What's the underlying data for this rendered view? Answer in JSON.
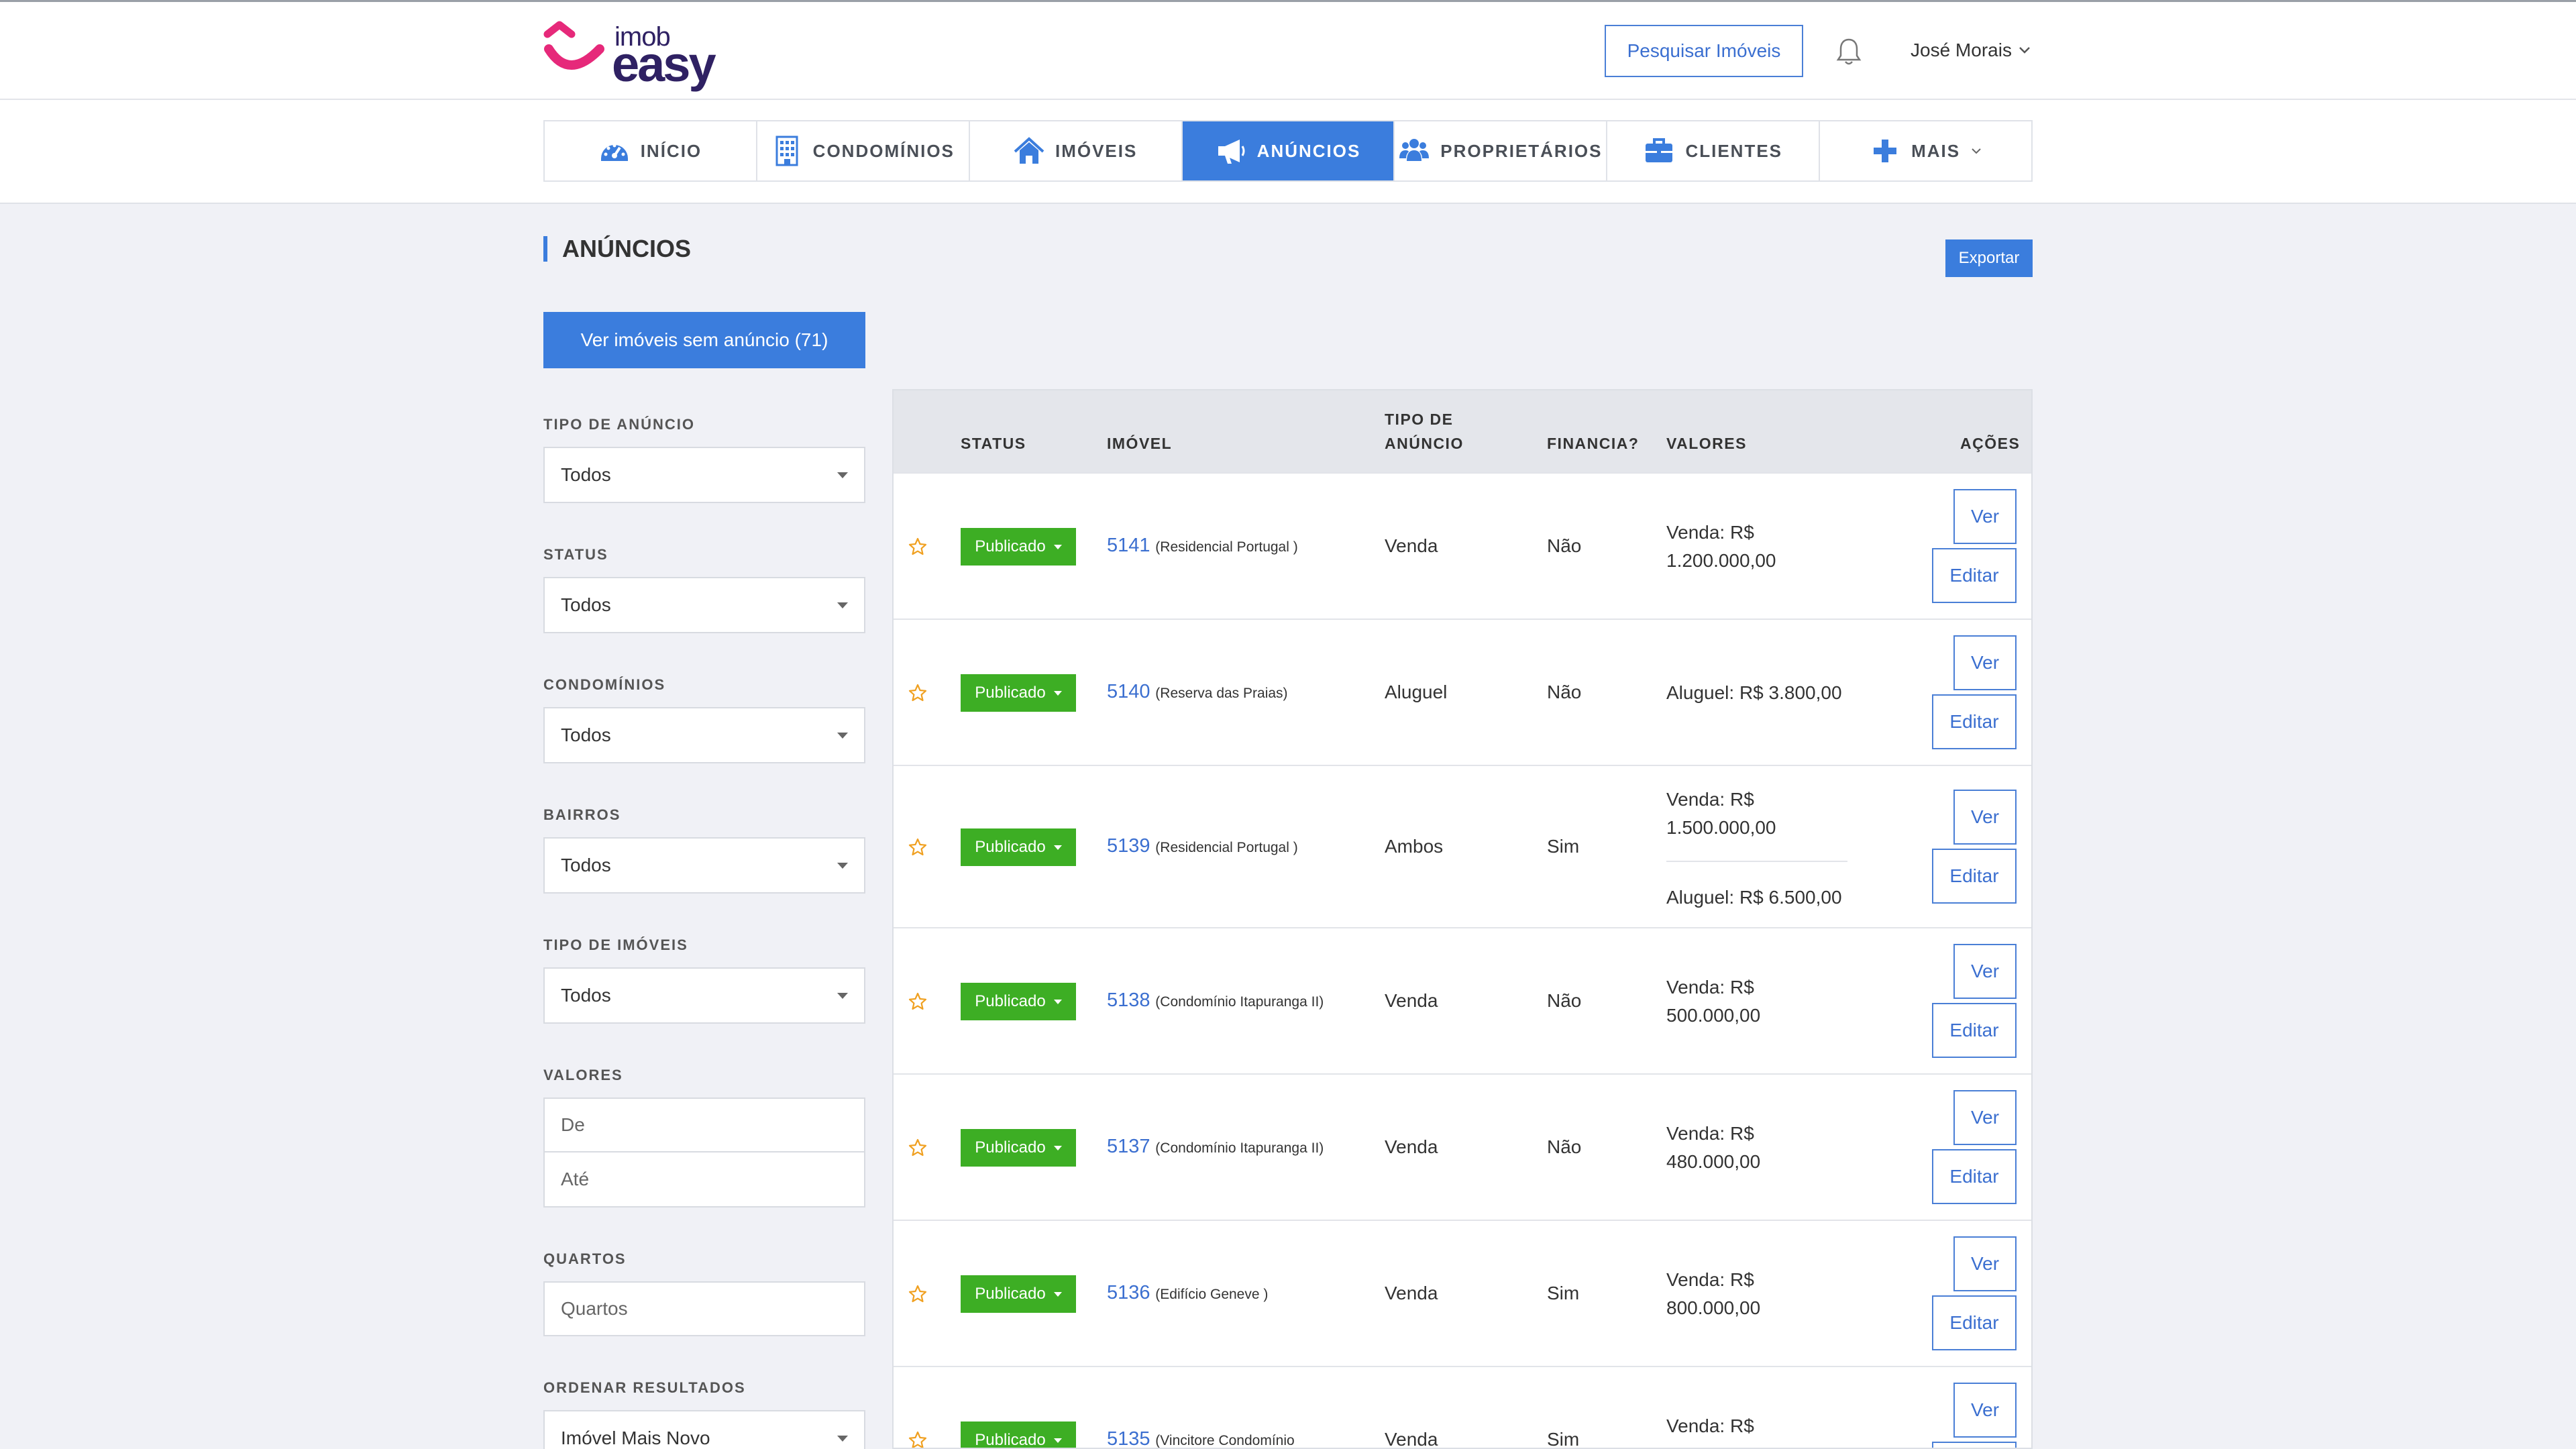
{
  "brand": {
    "top_text": "imob",
    "bottom_text": "easy",
    "colors": {
      "smile": "#e6297a",
      "text": "#2f2163"
    }
  },
  "header": {
    "search_button": "Pesquisar Imóveis",
    "user_name": "José Morais"
  },
  "nav": [
    {
      "label": "INÍCIO",
      "icon": "dashboard-icon"
    },
    {
      "label": "CONDOMÍNIOS",
      "icon": "building-icon"
    },
    {
      "label": "IMÓVEIS",
      "icon": "home-icon"
    },
    {
      "label": "ANÚNCIOS",
      "icon": "megaphone-icon",
      "active": true
    },
    {
      "label": "PROPRIETÁRIOS",
      "icon": "users-icon"
    },
    {
      "label": "CLIENTES",
      "icon": "briefcase-icon"
    },
    {
      "label": "MAIS",
      "icon": "plus-icon"
    }
  ],
  "page": {
    "title": "ANÚNCIOS",
    "export_button": "Exportar",
    "no_ad_button": "Ver imóveis sem anúncio (71)"
  },
  "filters": {
    "tipo_anuncio": {
      "label": "TIPO DE ANÚNCIO",
      "value": "Todos"
    },
    "status": {
      "label": "STATUS",
      "value": "Todos"
    },
    "condominios": {
      "label": "CONDOMÍNIOS",
      "value": "Todos"
    },
    "bairros": {
      "label": "BAIRROS",
      "value": "Todos"
    },
    "tipo_imoveis": {
      "label": "TIPO DE IMÓVEIS",
      "value": "Todos"
    },
    "valores": {
      "label": "VALORES",
      "de_placeholder": "De",
      "ate_placeholder": "Até"
    },
    "quartos": {
      "label": "QUARTOS",
      "placeholder": "Quartos"
    },
    "ordenar": {
      "label": "ORDENAR RESULTADOS",
      "value": "Imóvel Mais Novo"
    }
  },
  "table": {
    "headers": {
      "status": "STATUS",
      "imovel": "IMÓVEL",
      "tipo_line1": "TIPO DE",
      "tipo_line2": "ANÚNCIO",
      "financia": "FINANCIA?",
      "valores": "VALORES",
      "acoes": "AÇÕES"
    },
    "ver_label": "Ver",
    "editar_label": "Editar",
    "rows": [
      {
        "status": "Publicado",
        "code": "5141",
        "cond": "(Residencial Portugal )",
        "tipo": "Venda",
        "financia": "Não",
        "valor1a": "Venda: R$",
        "valor1b": "1.200.000,00"
      },
      {
        "status": "Publicado",
        "code": "5140",
        "cond": "(Reserva das Praias)",
        "tipo": "Aluguel",
        "financia": "Não",
        "valor1a": "Aluguel: R$ 3.800,00"
      },
      {
        "status": "Publicado",
        "code": "5139",
        "cond": "(Residencial Portugal )",
        "tipo": "Ambos",
        "financia": "Sim",
        "valor1a": "Venda: R$",
        "valor1b": "1.500.000,00",
        "valor2": "Aluguel: R$ 6.500,00"
      },
      {
        "status": "Publicado",
        "code": "5138",
        "cond": "(Condomínio Itapuranga II)",
        "tipo": "Venda",
        "financia": "Não",
        "valor1a": "Venda: R$",
        "valor1b": "500.000,00"
      },
      {
        "status": "Publicado",
        "code": "5137",
        "cond": "(Condomínio Itapuranga II)",
        "tipo": "Venda",
        "financia": "Não",
        "valor1a": "Venda: R$",
        "valor1b": "480.000,00"
      },
      {
        "status": "Publicado",
        "code": "5136",
        "cond": "(Edifício Geneve )",
        "tipo": "Venda",
        "financia": "Sim",
        "valor1a": "Venda: R$",
        "valor1b": "800.000,00"
      },
      {
        "status": "Publicado",
        "code": "5135",
        "cond": "(Vincitore Condomínio",
        "tipo": "Venda",
        "financia": "Sim",
        "valor1a": "Venda: R$",
        "valor1b": ""
      }
    ]
  },
  "colors": {
    "primary": "#3b7ddd",
    "published": "#3dae24",
    "star": "#f0a020"
  }
}
